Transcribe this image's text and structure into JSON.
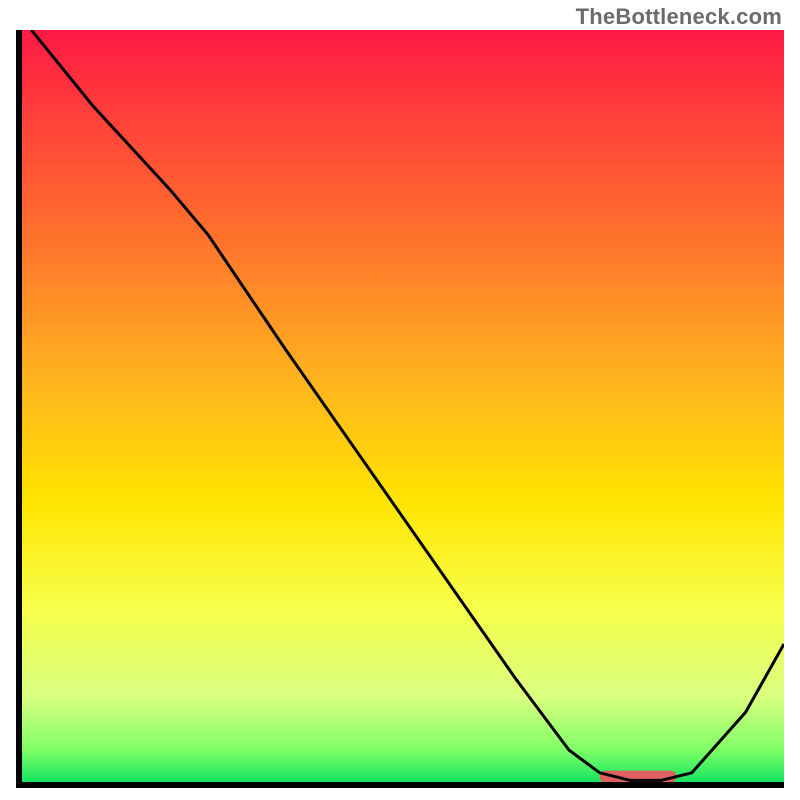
{
  "watermark": "TheBottleneck.com",
  "chart_data": {
    "type": "line",
    "title": "",
    "xlabel": "",
    "ylabel": "",
    "xlim": [
      0,
      100
    ],
    "ylim": [
      0,
      100
    ],
    "notes": "Bottleneck-style curve on rainbow vertical gradient background. Axes are unlabeled. Y represents bottleneck severity (high=red, low=green). X is an unlabeled parameter sweep. Values estimated from pixel positions.",
    "gradient_stops": [
      {
        "pct": 0,
        "color": "#ff1a44"
      },
      {
        "pct": 10,
        "color": "#ff3b3b"
      },
      {
        "pct": 25,
        "color": "#ff6a2e"
      },
      {
        "pct": 45,
        "color": "#ffb020"
      },
      {
        "pct": 62,
        "color": "#ffe400"
      },
      {
        "pct": 76,
        "color": "#f7ff4a"
      },
      {
        "pct": 88,
        "color": "#d9ff80"
      },
      {
        "pct": 95,
        "color": "#7fff66"
      },
      {
        "pct": 100,
        "color": "#00e060"
      }
    ],
    "series": [
      {
        "name": "bottleneck-curve",
        "color": "#000000",
        "x": [
          2,
          10,
          20,
          25,
          35,
          45,
          55,
          65,
          72,
          76,
          80,
          84,
          88,
          95,
          100
        ],
        "y": [
          100,
          90,
          79,
          73,
          58,
          43.5,
          29,
          14.5,
          5,
          2,
          1,
          1,
          2,
          10,
          19
        ]
      }
    ],
    "highlight_bar": {
      "name": "optimal-zone-marker",
      "color": "#e06060",
      "x_start": 76,
      "x_end": 86,
      "y": 1.5,
      "height_pct": 1.6
    }
  }
}
